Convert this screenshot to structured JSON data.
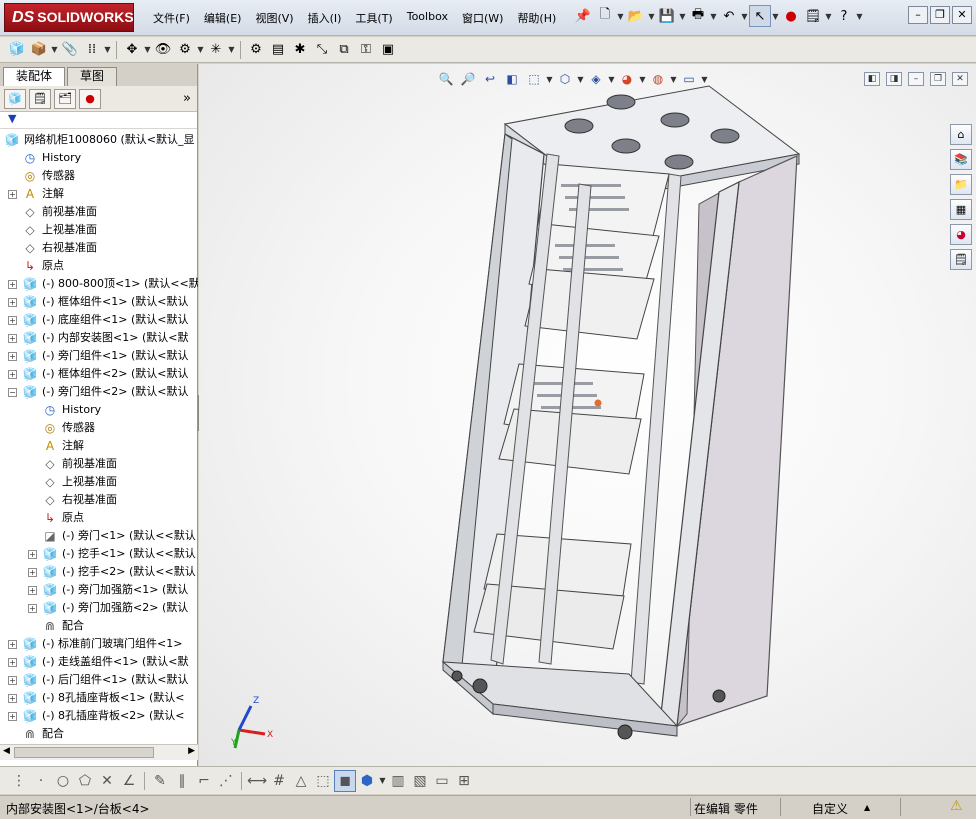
{
  "app": {
    "brand_ds": "DS",
    "brand_name": "SOLIDWORKS"
  },
  "menu": [
    "文件(F)",
    "编辑(E)",
    "视图(V)",
    "插入(I)",
    "工具(T)",
    "Toolbox",
    "窗口(W)",
    "帮助(H)"
  ],
  "panel_tabs": {
    "assembly": "装配体",
    "sketch": "草图"
  },
  "panel_more": "»",
  "tree": [
    {
      "label": "网络机柜1008060  (默认<默认_显",
      "icon": "assembly-root-icon",
      "expander": ""
    },
    {
      "label": "History",
      "icon": "history-icon",
      "expander": ""
    },
    {
      "label": "传感器",
      "icon": "sensor-icon",
      "expander": ""
    },
    {
      "label": "注解",
      "icon": "annotation-icon",
      "expander": "+"
    },
    {
      "label": "前视基准面",
      "icon": "plane-icon",
      "expander": ""
    },
    {
      "label": "上视基准面",
      "icon": "plane-icon",
      "expander": ""
    },
    {
      "label": "右视基准面",
      "icon": "plane-icon",
      "expander": ""
    },
    {
      "label": "原点",
      "icon": "origin-icon",
      "expander": ""
    },
    {
      "label": "(-) 800-800顶<1> (默认<<默",
      "icon": "subassembly-icon",
      "expander": "+"
    },
    {
      "label": "(-) 框体组件<1> (默认<默认",
      "icon": "subassembly-icon",
      "expander": "+"
    },
    {
      "label": "(-) 底座组件<1> (默认<默认",
      "icon": "subassembly-icon",
      "expander": "+"
    },
    {
      "label": "(-) 内部安装图<1> (默认<默",
      "icon": "subassembly-icon",
      "expander": "+"
    },
    {
      "label": "(-) 旁门组件<1> (默认<默认",
      "icon": "subassembly-icon",
      "expander": "+"
    },
    {
      "label": "(-) 框体组件<2> (默认<默认",
      "icon": "subassembly-icon",
      "expander": "+"
    },
    {
      "label": "(-) 旁门组件<2> (默认<默认",
      "icon": "subassembly-icon",
      "expander": "−"
    },
    {
      "label": "History",
      "icon": "history-icon",
      "expander": ""
    },
    {
      "label": "传感器",
      "icon": "sensor-icon",
      "expander": ""
    },
    {
      "label": "注解",
      "icon": "annotation-icon",
      "expander": ""
    },
    {
      "label": "前视基准面",
      "icon": "plane-icon",
      "expander": ""
    },
    {
      "label": "上视基准面",
      "icon": "plane-icon",
      "expander": ""
    },
    {
      "label": "右视基准面",
      "icon": "plane-icon",
      "expander": ""
    },
    {
      "label": "原点",
      "icon": "origin-icon",
      "expander": ""
    },
    {
      "label": "(-) 旁门<1> (默认<<默认",
      "icon": "part-icon",
      "expander": ""
    },
    {
      "label": "(-) 挖手<1> (默认<<默认",
      "icon": "subassembly-icon",
      "expander": "+"
    },
    {
      "label": "(-) 挖手<2> (默认<<默认",
      "icon": "subassembly-icon",
      "expander": "+"
    },
    {
      "label": "(-) 旁门加强筋<1> (默认",
      "icon": "subassembly-icon",
      "expander": "+"
    },
    {
      "label": "(-) 旁门加强筋<2> (默认",
      "icon": "subassembly-icon",
      "expander": "+"
    },
    {
      "label": "配合",
      "icon": "mates-icon",
      "expander": ""
    },
    {
      "label": "(-) 标准前门玻璃门组件<1>",
      "icon": "subassembly-icon",
      "expander": "+"
    },
    {
      "label": "(-) 走线盖组件<1> (默认<默",
      "icon": "subassembly-icon",
      "expander": "+"
    },
    {
      "label": "(-) 后门组件<1> (默认<默认",
      "icon": "subassembly-icon",
      "expander": "+"
    },
    {
      "label": "(-) 8孔插座背板<1> (默认<",
      "icon": "subassembly-icon",
      "expander": "+"
    },
    {
      "label": "(-) 8孔插座背板<2> (默认<",
      "icon": "subassembly-icon",
      "expander": "+"
    },
    {
      "label": "配合",
      "icon": "mates-icon",
      "expander": ""
    }
  ],
  "triad": {
    "x": "X",
    "y": "Y",
    "z": "Z"
  },
  "status": {
    "selection": "内部安装图<1>/台板<4>",
    "editing": "在编辑 零件",
    "units": "自定义",
    "units_arrow": "▲"
  },
  "colors": {
    "accent": "#c4232b",
    "axis_x": "#d62020",
    "axis_y": "#1ea31e",
    "axis_z": "#2448c8",
    "cabinet": "#e4e6eb",
    "cabinet_side": "#d9d2dc"
  }
}
